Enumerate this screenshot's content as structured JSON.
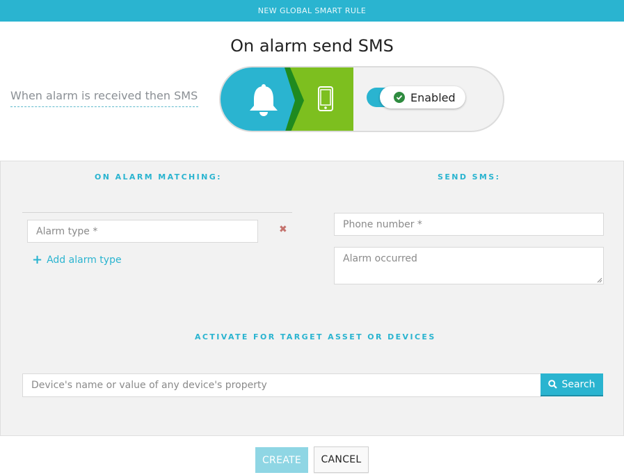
{
  "header": {
    "title": "NEW GLOBAL SMART RULE"
  },
  "rule": {
    "title": "On alarm send SMS",
    "description": "When alarm is received then SMS",
    "toggle_label": "Enabled"
  },
  "icons": {
    "trigger": "bell-icon",
    "action": "mobile-phone-icon",
    "status": "check-circle-icon",
    "search": "search-icon",
    "remove": "close-icon",
    "add": "plus-icon"
  },
  "colors": {
    "accent": "#2ab4d0",
    "action": "#7dbf1f",
    "remove": "#c4726d"
  },
  "alarm_section": {
    "heading": "ON ALARM MATCHING:",
    "alarm_type_placeholder": "Alarm type *",
    "remove_label": "✖",
    "add_label": "Add alarm type"
  },
  "sms_section": {
    "heading": "SEND SMS:",
    "phone_placeholder": "Phone number *",
    "message_value": "Alarm occurred"
  },
  "target_section": {
    "heading": "ACTIVATE FOR TARGET ASSET OR DEVICES",
    "search_placeholder": "Device's name or value of any device's property",
    "search_label": "Search"
  },
  "footer": {
    "create_label": "CREATE",
    "cancel_label": "CANCEL"
  }
}
